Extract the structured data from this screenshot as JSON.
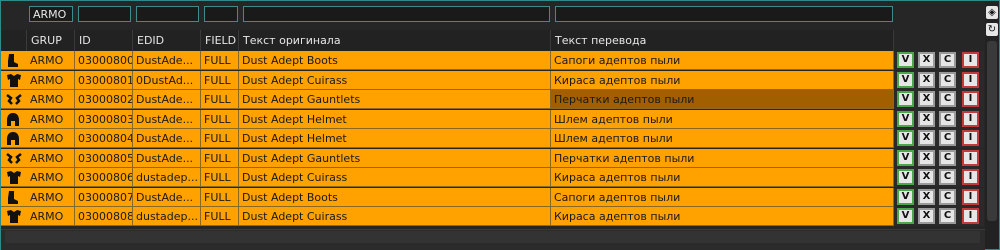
{
  "filters": {
    "grup": "ARMO",
    "id": "",
    "edid": "",
    "field": "",
    "original": "",
    "translation": ""
  },
  "header": {
    "grup": "GRUP",
    "id": "ID",
    "edid": "EDID",
    "field": "FIELD",
    "original": "Текст оригинала",
    "translation": "Текст перевода"
  },
  "buttons": {
    "v": "V",
    "x": "X",
    "c": "C",
    "i": "I"
  },
  "scroll": {
    "top_icon": "◈",
    "refresh_icon": "↻"
  },
  "rows": [
    {
      "icon": "boots-icon",
      "grup": "ARMO",
      "id": "03000800",
      "edid": "DustAde...",
      "field": "FULL",
      "original": "Dust Adept Boots",
      "translation": "Сапоги адептов пыли",
      "highlight": false
    },
    {
      "icon": "cuirass-icon",
      "grup": "ARMO",
      "id": "03000801",
      "edid": "0DustAd...",
      "field": "FULL",
      "original": "Dust Adept Cuirass",
      "translation": "Кираса адептов пыли",
      "highlight": false
    },
    {
      "icon": "gauntlets-icon",
      "grup": "ARMO",
      "id": "03000802",
      "edid": "DustAde...",
      "field": "FULL",
      "original": "Dust Adept Gauntlets",
      "translation": "Перчатки адептов пыли",
      "highlight": true
    },
    {
      "icon": "helmet-icon",
      "grup": "ARMO",
      "id": "03000803",
      "edid": "DustAde...",
      "field": "FULL",
      "original": "Dust Adept Helmet",
      "translation": "Шлем адептов пыли",
      "highlight": false
    },
    {
      "icon": "helmet-icon",
      "grup": "ARMO",
      "id": "03000804",
      "edid": "DustAde...",
      "field": "FULL",
      "original": "Dust Adept Helmet",
      "translation": "Шлем адептов пыли",
      "highlight": false
    },
    {
      "icon": "gauntlets-icon",
      "grup": "ARMO",
      "id": "03000805",
      "edid": "DustAde...",
      "field": "FULL",
      "original": "Dust Adept Gauntlets",
      "translation": "Перчатки адептов пыли",
      "highlight": false
    },
    {
      "icon": "cuirass-icon",
      "grup": "ARMO",
      "id": "03000806",
      "edid": "dustadep...",
      "field": "FULL",
      "original": "Dust Adept Cuirass",
      "translation": "Кираса адептов пыли",
      "highlight": false
    },
    {
      "icon": "boots-icon",
      "grup": "ARMO",
      "id": "03000807",
      "edid": "DustAde...",
      "field": "FULL",
      "original": "Dust Adept Boots",
      "translation": "Сапоги адептов пыли",
      "highlight": false
    },
    {
      "icon": "cuirass-icon",
      "grup": "ARMO",
      "id": "03000808",
      "edid": "dustadep...",
      "field": "FULL",
      "original": "Dust Adept Cuirass",
      "translation": "Кираса адептов пыли",
      "highlight": false
    }
  ]
}
